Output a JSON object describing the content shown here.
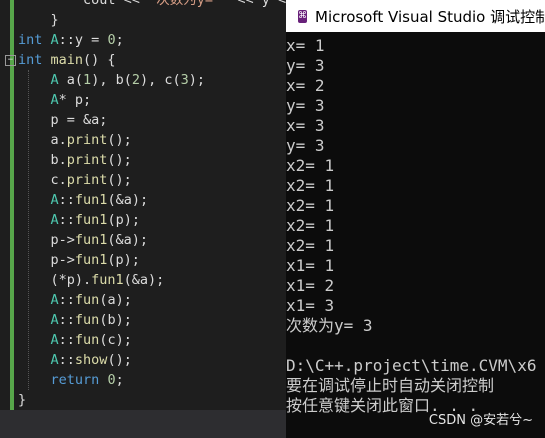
{
  "editor": {
    "lines": [
      {
        "indent": "        ",
        "segments": [
          [
            "",
            "cout << "
          ],
          [
            "str",
            "\"次数为y= \""
          ],
          [
            "",
            " << y << endl;"
          ]
        ]
      },
      {
        "indent": "    ",
        "segments": [
          [
            "",
            "}"
          ]
        ]
      },
      {
        "indent": "",
        "segments": [
          [
            "kw",
            "int"
          ],
          [
            "",
            " "
          ],
          [
            "cls",
            "A"
          ],
          [
            "",
            "::y = "
          ],
          [
            "num",
            "0"
          ],
          [
            "",
            ";"
          ]
        ]
      },
      {
        "indent": "",
        "segments": [
          [
            "kw",
            "int"
          ],
          [
            "",
            " "
          ],
          [
            "fn",
            "main"
          ],
          [
            "",
            "() {"
          ]
        ]
      },
      {
        "indent": "    ",
        "segments": [
          [
            "cls",
            "A"
          ],
          [
            "",
            " a("
          ],
          [
            "num",
            "1"
          ],
          [
            "",
            "), b("
          ],
          [
            "num",
            "2"
          ],
          [
            "",
            "), c("
          ],
          [
            "num",
            "3"
          ],
          [
            "",
            ");"
          ]
        ]
      },
      {
        "indent": "    ",
        "segments": [
          [
            "cls",
            "A"
          ],
          [
            "",
            "* p;"
          ]
        ]
      },
      {
        "indent": "    ",
        "segments": [
          [
            "",
            "p = &a;"
          ]
        ]
      },
      {
        "indent": "    ",
        "segments": [
          [
            "",
            "a."
          ],
          [
            "fn",
            "print"
          ],
          [
            "",
            "();"
          ]
        ]
      },
      {
        "indent": "    ",
        "segments": [
          [
            "",
            "b."
          ],
          [
            "fn",
            "print"
          ],
          [
            "",
            "();"
          ]
        ]
      },
      {
        "indent": "    ",
        "segments": [
          [
            "",
            "c."
          ],
          [
            "fn",
            "print"
          ],
          [
            "",
            "();"
          ]
        ]
      },
      {
        "indent": "    ",
        "segments": [
          [
            "cls",
            "A"
          ],
          [
            "",
            "::"
          ],
          [
            "fn",
            "fun1"
          ],
          [
            "",
            "(&a);"
          ]
        ]
      },
      {
        "indent": "    ",
        "segments": [
          [
            "cls",
            "A"
          ],
          [
            "",
            "::"
          ],
          [
            "fn",
            "fun1"
          ],
          [
            "",
            "(p);"
          ]
        ]
      },
      {
        "indent": "    ",
        "segments": [
          [
            "",
            "p->"
          ],
          [
            "fn",
            "fun1"
          ],
          [
            "",
            "(&a);"
          ]
        ]
      },
      {
        "indent": "    ",
        "segments": [
          [
            "",
            "p->"
          ],
          [
            "fn",
            "fun1"
          ],
          [
            "",
            "(p);"
          ]
        ]
      },
      {
        "indent": "    ",
        "segments": [
          [
            "",
            "(*p)."
          ],
          [
            "fn",
            "fun1"
          ],
          [
            "",
            "(&a);"
          ]
        ]
      },
      {
        "indent": "    ",
        "segments": [
          [
            "cls",
            "A"
          ],
          [
            "",
            "::"
          ],
          [
            "fn",
            "fun"
          ],
          [
            "",
            "(a);"
          ]
        ]
      },
      {
        "indent": "    ",
        "segments": [
          [
            "cls",
            "A"
          ],
          [
            "",
            "::"
          ],
          [
            "fn",
            "fun"
          ],
          [
            "",
            "(b);"
          ]
        ]
      },
      {
        "indent": "    ",
        "segments": [
          [
            "cls",
            "A"
          ],
          [
            "",
            "::"
          ],
          [
            "fn",
            "fun"
          ],
          [
            "",
            "(c);"
          ]
        ]
      },
      {
        "indent": "    ",
        "segments": [
          [
            "cls",
            "A"
          ],
          [
            "",
            "::"
          ],
          [
            "fn",
            "show"
          ],
          [
            "",
            "();"
          ]
        ]
      },
      {
        "indent": "    ",
        "segments": [
          [
            "kw",
            "return"
          ],
          [
            "",
            " "
          ],
          [
            "num",
            "0"
          ],
          [
            "",
            ";"
          ]
        ]
      },
      {
        "indent": "",
        "segments": [
          [
            "",
            "}"
          ]
        ]
      }
    ]
  },
  "console": {
    "title": "Microsoft Visual Studio 调试控制",
    "icon": "vs-icon",
    "output_lines": [
      "x= 1",
      "y= 3",
      "x= 2",
      "y= 3",
      "x= 3",
      "y= 3",
      "x2= 1",
      "x2= 1",
      "x2= 1",
      "x2= 1",
      "x2= 1",
      "x1= 1",
      "x1= 2",
      "x1= 3",
      "次数为y= 3",
      "",
      "D:\\C++.project\\time.CVM\\x6",
      "要在调试停止时自动关闭控制",
      "按任意键关闭此窗口. . ."
    ]
  },
  "watermark": "CSDN @安若兮~",
  "colors": {
    "editor_bg": "#1e1e1e",
    "console_bg": "#0c0c0c",
    "keyword": "#569cd6",
    "function": "#dcdcaa",
    "class": "#4ec9b0",
    "string": "#d69d85",
    "number": "#b5cea8",
    "change_bar": "#57a64a"
  }
}
